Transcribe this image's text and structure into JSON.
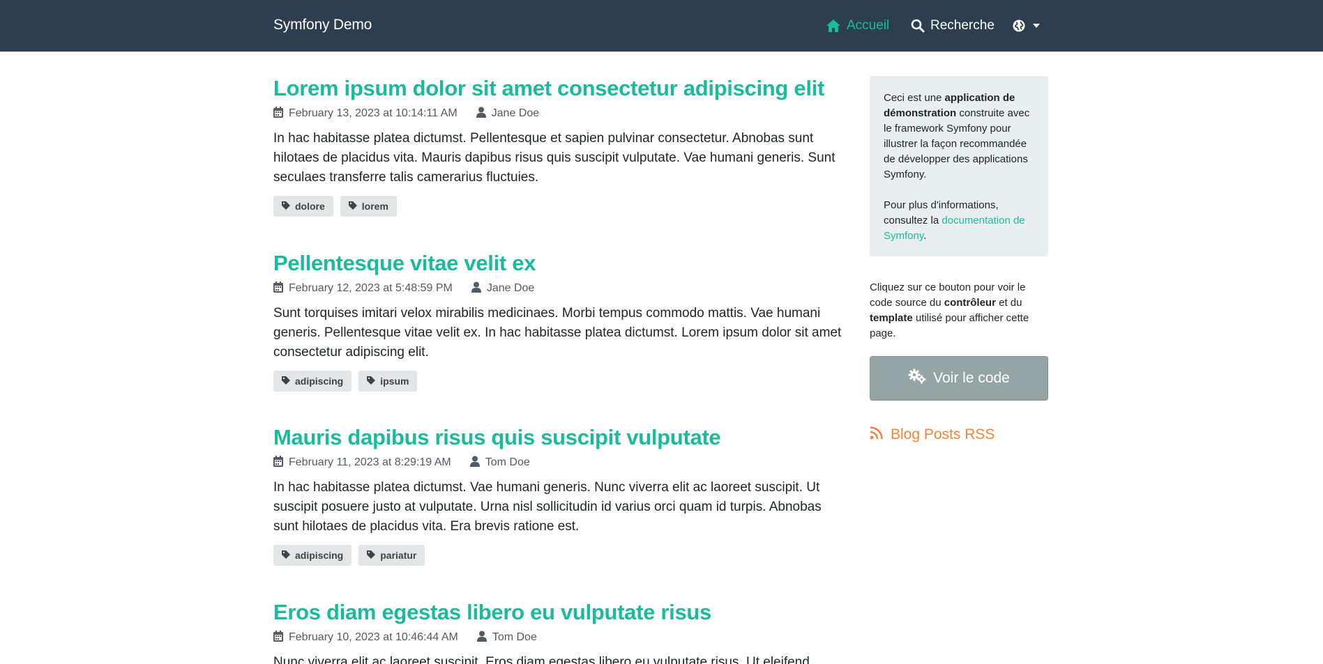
{
  "navbar": {
    "brand": "Symfony Demo",
    "home_label": "Accueil",
    "search_label": "Recherche"
  },
  "posts": [
    {
      "title": "Lorem ipsum dolor sit amet consectetur adipiscing elit",
      "date": "February 13, 2023 at 10:14:11 AM",
      "author": "Jane Doe",
      "summary": "In hac habitasse platea dictumst. Pellentesque et sapien pulvinar consectetur. Abnobas sunt hilotaes de placidus vita. Mauris dapibus risus quis suscipit vulputate. Vae humani generis. Sunt seculaes transferre talis camerarius fluctuies.",
      "tags": [
        "dolore",
        "lorem"
      ]
    },
    {
      "title": "Pellentesque vitae velit ex",
      "date": "February 12, 2023 at 5:48:59 PM",
      "author": "Jane Doe",
      "summary": "Sunt torquises imitari velox mirabilis medicinaes. Morbi tempus commodo mattis. Vae humani generis. Pellentesque vitae velit ex. In hac habitasse platea dictumst. Lorem ipsum dolor sit amet consectetur adipiscing elit.",
      "tags": [
        "adipiscing",
        "ipsum"
      ]
    },
    {
      "title": "Mauris dapibus risus quis suscipit vulputate",
      "date": "February 11, 2023 at 8:29:19 AM",
      "author": "Tom Doe",
      "summary": "In hac habitasse platea dictumst. Vae humani generis. Nunc viverra elit ac laoreet suscipit. Ut suscipit posuere justo at vulputate. Urna nisl sollicitudin id varius orci quam id turpis. Abnobas sunt hilotaes de placidus vita. Era brevis ratione est.",
      "tags": [
        "adipiscing",
        "pariatur"
      ]
    },
    {
      "title": "Eros diam egestas libero eu vulputate risus",
      "date": "February 10, 2023 at 10:46:44 AM",
      "author": "Tom Doe",
      "summary": "Nunc viverra elit ac laoreet suscipit. Eros diam egestas libero eu vulputate risus. Ut eleifend mauris",
      "tags": []
    }
  ],
  "sidebar": {
    "about": {
      "p1_prefix": "Ceci est une ",
      "p1_bold": "application de démonstration",
      "p1_suffix": " construite avec le framework Symfony pour illustrer la façon recommandée de développer des applications Symfony.",
      "p2_prefix": "Pour plus d'informations, consultez la ",
      "p2_link": "documentation de Symfony",
      "p2_suffix": "."
    },
    "code_help": {
      "part1": "Cliquez sur ce bouton pour voir le code source du ",
      "bold1": "contrôleur",
      "part2": " et du ",
      "bold2": "template",
      "part3": " utilisé pour afficher cette page."
    },
    "code_button_label": "Voir le code",
    "rss_label": "Blog Posts RSS"
  },
  "colors": {
    "navbar_bg": "#2c3e50",
    "accent": "#18bc9c",
    "rss": "#f0843c",
    "button_bg": "#95a5a6",
    "about_bg": "#e9eff0",
    "tag_bg": "#e3e5e6"
  },
  "icons": {
    "home": "home-icon",
    "search": "search-icon",
    "language": "globe-icon",
    "date": "calendar-icon",
    "author": "user-icon",
    "tag": "tag-icon",
    "code": "cogs-icon",
    "rss": "rss-icon"
  }
}
